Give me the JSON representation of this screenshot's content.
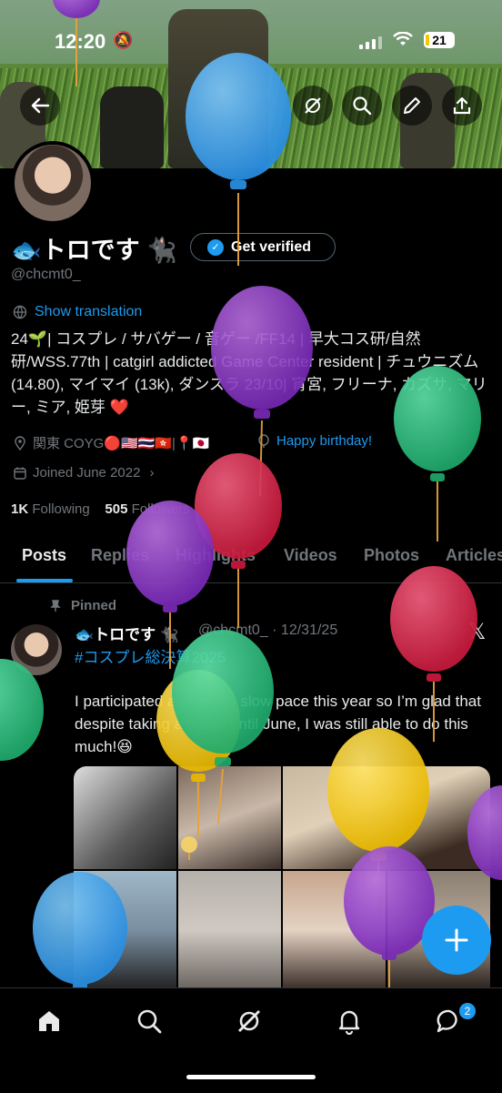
{
  "status": {
    "time": "12:20",
    "battery": "21"
  },
  "profile": {
    "name": "🐟トロです 🐈‍⬛",
    "get_verified": "Get verified",
    "handle": "@chcmt0_",
    "show_translation": "Show translation",
    "bio": "24🌱| コスプレ / サバゲー / 音ゲー /FF14 | 早大コス研/自然研/WSS.77th | catgirl addicted Game Center resident | チュウニズム (14.80), マイマイ (13k), ダンスラ 23/10| 宵宮, フリーナ, カズサ, マリー, ミア, 姫芽 ❤️",
    "location": "関東 COYG🔴🇺🇸🇹🇭🇭🇰|📍🇯🇵",
    "birthday": "Happy birthday!",
    "joined": "Joined June 2022",
    "following_count": "1K",
    "following_label": "Following",
    "followers_count": "505",
    "followers_label": "Followers"
  },
  "tabs": [
    "Posts",
    "Replies",
    "Highlights",
    "Videos",
    "Photos",
    "Articles"
  ],
  "post": {
    "pinned": "Pinned",
    "name": "🐟トロです 🐈‍⬛",
    "handle_date": "@chcmt0_ · 12/31/25",
    "hashtag": "#コスプレ総決算2025",
    "text": "I participated at a pretty slow pace this year so I’m glad that despite taking a break until June, I was still able to do this much!😆"
  },
  "bottom_nav": {
    "messages_badge": "2"
  },
  "colors": {
    "accent": "#1d9bf0",
    "background": "#000000",
    "muted": "#71767b"
  },
  "icons": [
    "back-arrow-icon",
    "grok-icon",
    "search-icon",
    "edit-icon",
    "share-icon",
    "home-icon",
    "explore-icon",
    "notifications-icon",
    "messages-icon",
    "plus-icon"
  ]
}
